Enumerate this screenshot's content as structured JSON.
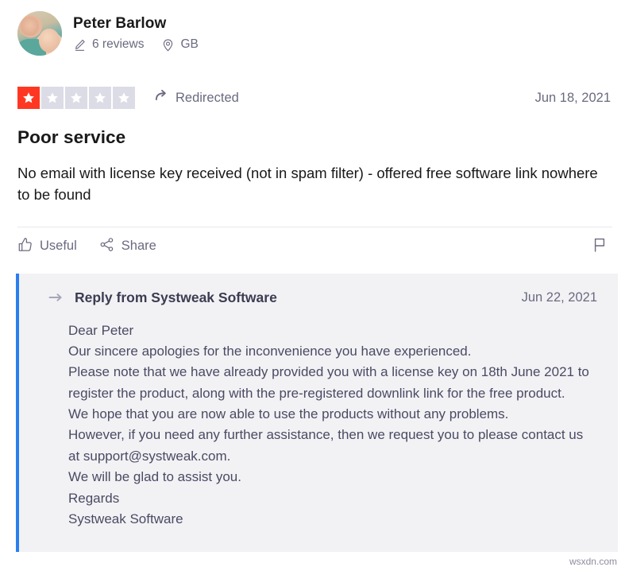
{
  "consumer": {
    "name": "Peter Barlow",
    "reviews_count": "6 reviews",
    "location": "GB",
    "reviews_icon": "pencil-icon",
    "location_icon": "map-pin-icon",
    "avatar_icon": "user-avatar-photo"
  },
  "rating": {
    "value": 1,
    "max": 5,
    "filled_color": "#ff3722",
    "empty_color": "#dcdce6",
    "redirected_label": "Redirected",
    "redirected_icon": "redirect-arrow-icon"
  },
  "review": {
    "date": "Jun 18, 2021",
    "title": "Poor service",
    "body": "No email with license key received (not in spam filter) - offered free software link nowhere to be found"
  },
  "actions": {
    "useful_label": "Useful",
    "useful_icon": "thumbs-up-icon",
    "share_label": "Share",
    "share_icon": "share-icon",
    "flag_icon": "flag-icon"
  },
  "reply": {
    "title": "Reply from Systweak Software",
    "date": "Jun 22, 2021",
    "arrow_icon": "reply-arrow-icon",
    "accent_color": "#2b7ef0",
    "background_color": "#f2f2f5",
    "lines": [
      "Dear Peter",
      "Our sincere apologies for the inconvenience you have experienced.",
      "Please note that we have already provided you with a license key on 18th June 2021 to register the product, along with the pre-registered downlink link for the free product.",
      "We hope that you are now able to use the products without any problems.",
      "However, if you need any further assistance, then we request you to please contact us at support@systweak.com.",
      "We will be glad to assist you.",
      "Regards",
      "Systweak Software"
    ]
  },
  "watermark": "wsxdn.com"
}
